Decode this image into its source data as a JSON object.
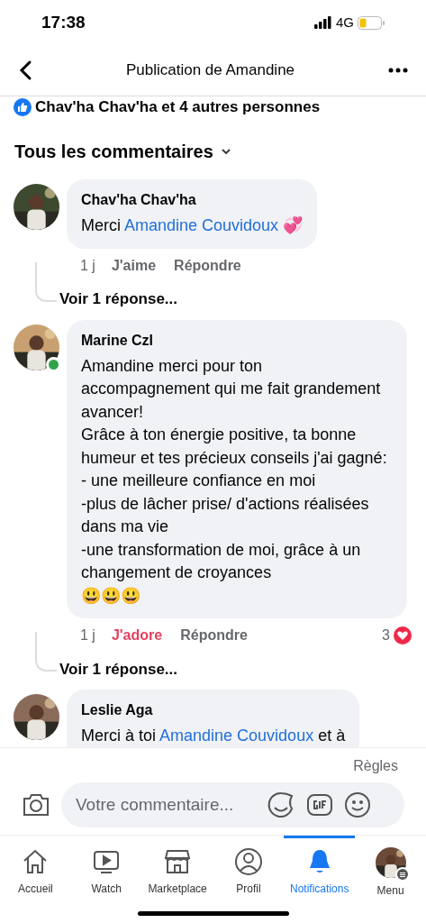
{
  "status_bar": {
    "time": "17:38",
    "network": "4G"
  },
  "header": {
    "title": "Publication de Amandine"
  },
  "likes": {
    "text": "Chav'ha Chav'ha et 4 autres personnes"
  },
  "filter": {
    "label": "Tous les commentaires"
  },
  "comments": [
    {
      "author": "Chav'ha Chav'ha",
      "online": false,
      "lines": [
        [
          {
            "kind": "text",
            "text": "Merci "
          },
          {
            "kind": "mention",
            "text": "Amandine Couvidoux"
          },
          {
            "kind": "text",
            "text": " 💞"
          }
        ]
      ],
      "time": "1 j",
      "reaction": {
        "label": "J'aime",
        "reacted": false
      },
      "reply": "Répondre",
      "replies_link": "Voir 1 réponse..."
    },
    {
      "author": "Marine Czl",
      "online": true,
      "lines": [
        [
          {
            "kind": "text",
            "text": "Amandine merci pour ton accompagnement qui me fait grandement avancer!"
          }
        ],
        [
          {
            "kind": "text",
            "text": "Grâce à ton énergie positive, ta bonne humeur et tes précieux conseils j'ai gagné:"
          }
        ],
        [
          {
            "kind": "text",
            "text": "- une meilleure confiance en moi"
          }
        ],
        [
          {
            "kind": "text",
            "text": "-plus de lâcher prise/ d'actions réalisées dans ma vie"
          }
        ],
        [
          {
            "kind": "text",
            "text": "-une transformation de moi, grâce à un changement de croyances"
          }
        ],
        [
          {
            "kind": "text",
            "text": "😃😃😃"
          }
        ]
      ],
      "time": "1 j",
      "reaction": {
        "label": "J'adore",
        "reacted": true
      },
      "reply": "Répondre",
      "reaction_count": "3",
      "replies_link": "Voir 1 réponse..."
    },
    {
      "author": "Leslie Aga",
      "online": false,
      "lines": [
        [
          {
            "kind": "text",
            "text": "Merci à toi "
          },
          {
            "kind": "mention",
            "text": "Amandine Couvidoux"
          },
          {
            "kind": "text",
            "text": " et à"
          }
        ]
      ]
    }
  ],
  "rules_link": "Règles",
  "composer": {
    "placeholder": "Votre commentaire..."
  },
  "tabs": [
    {
      "label": "Accueil",
      "kind": "home",
      "selected": false
    },
    {
      "label": "Watch",
      "kind": "watch",
      "selected": false
    },
    {
      "label": "Marketplace",
      "kind": "shop",
      "selected": false
    },
    {
      "label": "Profil",
      "kind": "profile",
      "selected": false
    },
    {
      "label": "Notifications",
      "kind": "bell",
      "selected": true
    },
    {
      "label": "Menu",
      "kind": "avatar",
      "selected": false
    }
  ]
}
